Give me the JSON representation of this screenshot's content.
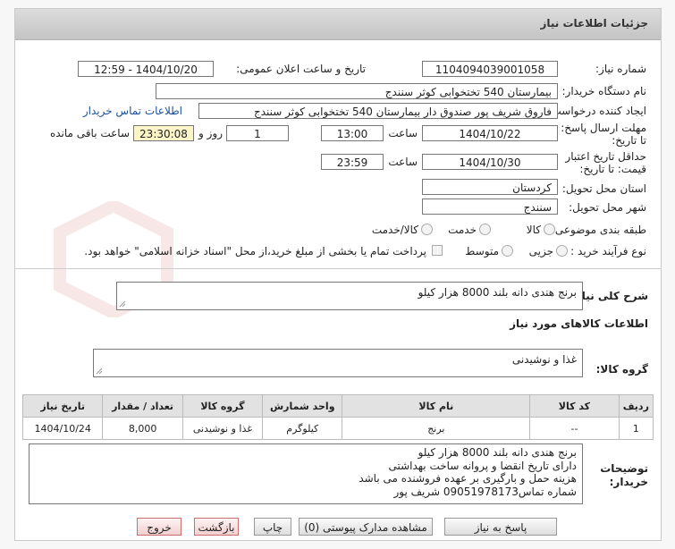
{
  "panel": {
    "title": "جزئیات اطلاعات نیاز"
  },
  "form": {
    "need_number": {
      "label": "شماره نیاز:",
      "value": "1104094039001058"
    },
    "announce": {
      "label": "تاریخ و ساعت اعلان عمومی:",
      "value": "1404/10/20 - 12:59"
    },
    "buyer_org": {
      "label": "نام دستگاه خریدار:",
      "value": "بیمارستان 540 تختخوابی کوثر سنندج"
    },
    "requester": {
      "label": "ایجاد کننده درخواست:",
      "value": "فاروق شریف پور صندوق دار بیمارستان 540 تختخوابی کوثر سنندج"
    },
    "contact_link": "اطلاعات تماس خریدار",
    "deadline": {
      "label": "مهلت ارسال پاسخ: تا تاریخ:",
      "date": "1404/10/22",
      "time_label": "ساعت",
      "time": "13:00",
      "days": "1",
      "days_label": "روز و",
      "remaining": "23:30:08",
      "remaining_label": "ساعت باقی مانده"
    },
    "validity": {
      "label": "حداقل تاریخ اعتبار قیمت: تا تاریخ:",
      "date": "1404/10/30",
      "time_label": "ساعت",
      "time": "23:59"
    },
    "province": {
      "label": "استان محل تحویل:",
      "value": "کردستان"
    },
    "city": {
      "label": "شهر محل تحویل:",
      "value": "سنندج"
    },
    "category": {
      "label": "طبقه بندی موضوعی:",
      "options": [
        "کالا",
        "خدمت",
        "کالا/خدمت"
      ]
    },
    "process": {
      "label": "نوع فرآیند خرید :",
      "options": [
        "جزیی",
        "متوسط"
      ],
      "payment_note": "پرداخت تمام یا بخشی از مبلغ خرید،از محل \"اسناد خزانه اسلامی\" خواهد بود."
    }
  },
  "summary": {
    "label": "شرح کلی نیاز:",
    "value": "برنج هندی دانه بلند 8000 هزار کیلو"
  },
  "goods": {
    "section_title": "اطلاعات کالاهای مورد نیاز",
    "group_label": "گروه کالا:",
    "group_value": "غذا و نوشیدنی",
    "columns": [
      "ردیف",
      "کد کالا",
      "نام کالا",
      "واحد شمارش",
      "گروه کالا",
      "تعداد / مقدار",
      "تاریخ نیاز"
    ],
    "rows": [
      [
        "1",
        "--",
        "برنج",
        "کیلوگرم",
        "غذا و نوشیدنی",
        "8,000",
        "1404/10/24"
      ]
    ]
  },
  "buyer_notes": {
    "label": "توضیحات خریدار:",
    "lines": [
      "برنج هندی دانه بلند 8000 هزار کیلو",
      "دارای تاریخ انقضا و پروانه ساخت بهداشتی",
      "هزینه حمل و بارگیری بر عهده فروشنده می باشد",
      "شماره تماس09051978173 شریف پور"
    ]
  },
  "buttons": {
    "reply": "پاسخ به نیاز",
    "attachments": "مشاهده مدارک پیوستی (0)",
    "print": "چاپ",
    "back": "بازگشت",
    "exit": "خروج"
  },
  "colors": {
    "header": "#cfcfcf",
    "remaining_bg": "#fdf5c8",
    "link": "#1a4f9c",
    "red_button": "#f2cfcf"
  }
}
